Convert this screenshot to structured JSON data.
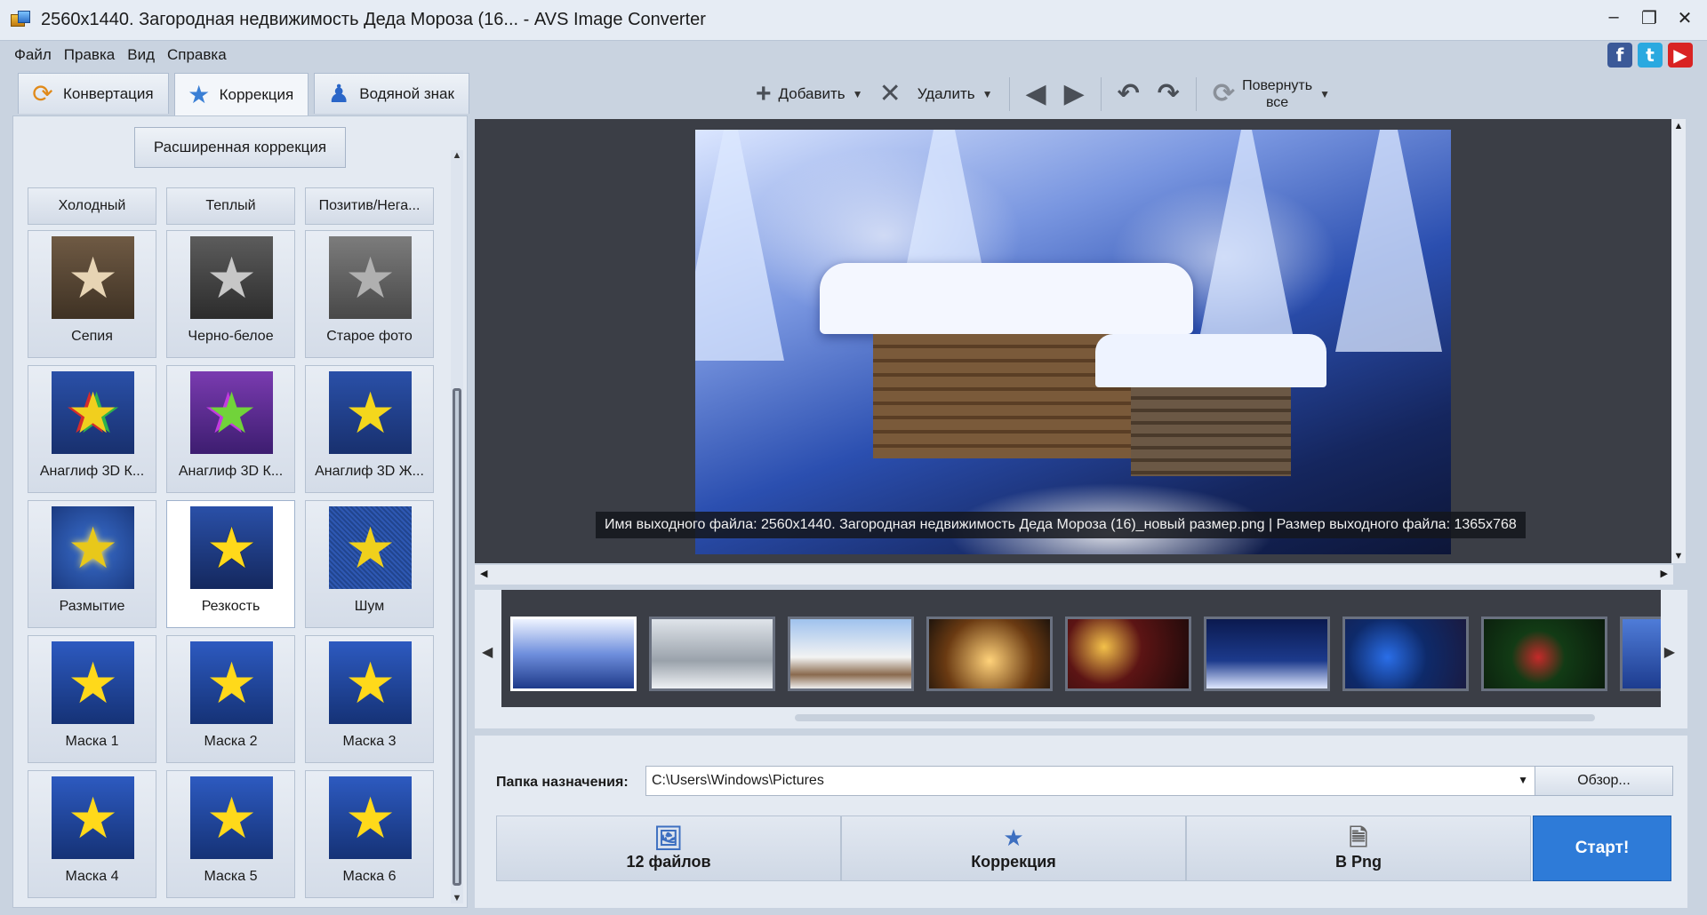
{
  "window": {
    "title": "2560x1440. Загородная недвижимость Деда Мороза (16... - AVS Image Converter"
  },
  "menu": [
    "Файл",
    "Правка",
    "Вид",
    "Справка"
  ],
  "social": {
    "facebook": "f",
    "twitter": "t",
    "youtube": "▶"
  },
  "tabs": [
    {
      "label": "Конвертация",
      "icon": "convert-icon"
    },
    {
      "label": "Коррекция",
      "icon": "star-icon"
    },
    {
      "label": "Водяной знак",
      "icon": "watermark-icon"
    }
  ],
  "toolbar": {
    "add_label": "Добавить",
    "delete_label": "Удалить",
    "rotate_all_line1": "Повернуть",
    "rotate_all_line2": "все"
  },
  "left_panel": {
    "advanced_button": "Расширенная коррекция",
    "headers": [
      "Холодный",
      "Теплый",
      "Позитив/Нега..."
    ],
    "effects": [
      {
        "label": "Сепия",
        "style": "sepia"
      },
      {
        "label": "Черно-белое",
        "style": "bw"
      },
      {
        "label": "Старое фото",
        "style": "old"
      },
      {
        "label": "Анаглиф 3D К...",
        "style": "ana1"
      },
      {
        "label": "Анаглиф 3D К...",
        "style": "ana2"
      },
      {
        "label": "Анаглиф 3D Ж...",
        "style": "ana3"
      },
      {
        "label": "Размытие",
        "style": "blur"
      },
      {
        "label": "Резкость",
        "style": "sharp",
        "selected": true
      },
      {
        "label": "Шум",
        "style": "noise"
      },
      {
        "label": "Маска 1",
        "style": "mask"
      },
      {
        "label": "Маска 2",
        "style": "mask"
      },
      {
        "label": "Маска 3",
        "style": "mask"
      },
      {
        "label": "Маска 4",
        "style": "mask"
      },
      {
        "label": "Маска 5",
        "style": "mask"
      },
      {
        "label": "Маска 6",
        "style": "mask"
      }
    ]
  },
  "preview": {
    "caption": "Имя выходного файла: 2560x1440. Загородная недвижимость Деда Мороза (16)_новый размер.png | Размер выходного файла: 1365x768"
  },
  "bottom": {
    "dest_label": "Папка назначения:",
    "dest_value": "C:\\Users\\Windows\\Pictures",
    "browse_label": "Обзор...",
    "step_files": "12 файлов",
    "step_correction": "Коррекция",
    "step_format": "В Png",
    "start_label": "Старт!"
  },
  "colors": {
    "accent": "#2e7bd8",
    "preview_bg": "#3b3e46"
  }
}
